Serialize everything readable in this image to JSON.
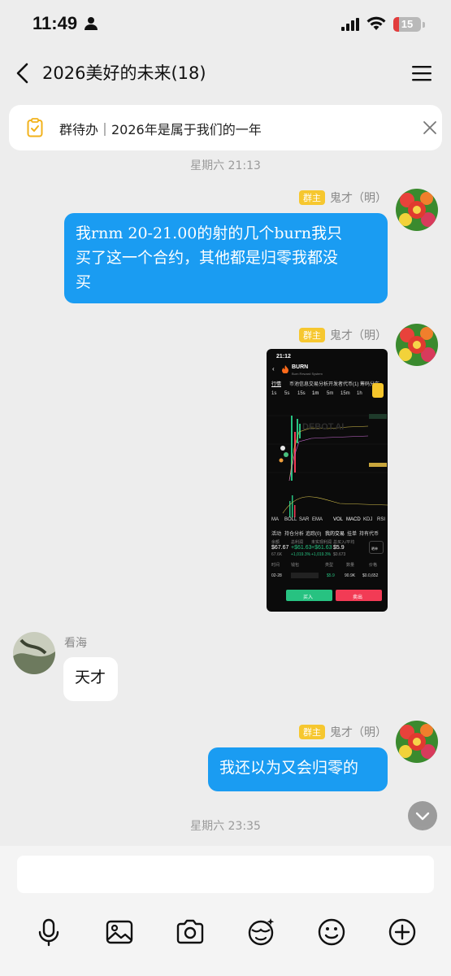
{
  "status_bar": {
    "time": "11:49",
    "battery": "15"
  },
  "header": {
    "title": "2026美好的未来(18)"
  },
  "group_todo": {
    "text": "群待办｜2026年是属于我们的一年"
  },
  "messages": [
    {
      "type": "timestamp",
      "text": "星期六 21:13"
    },
    {
      "type": "outgoing_text",
      "badge": "群主",
      "sender": "鬼才（明）",
      "lines": [
        "我rnm 20-21.00的射的几个burn我只",
        "买了这一个合约，其他都是归零我都没",
        "买"
      ]
    },
    {
      "type": "outgoing_image",
      "badge": "群主",
      "sender": "鬼才（明）",
      "image": {
        "time": "21:12",
        "token": "BURN",
        "subtitle": "Burn Reward System",
        "tabs": [
          "行情",
          "币池信息",
          "交易分析",
          "开发者代币(1)",
          "筹码分布"
        ],
        "intervals": [
          "1s",
          "5s",
          "15s",
          "1m",
          "5m",
          "15m",
          "1h"
        ],
        "watermark": "DEBOT.AI",
        "indicators": [
          "MA",
          "BOLL",
          "SAR",
          "EMA",
          "VOL",
          "MACD",
          "KDJ",
          "RSI"
        ],
        "sub_tabs": [
          "活动",
          "持仓分析",
          "追踪(0)",
          "我的交易",
          "挂单",
          "持有代币"
        ],
        "stats": [
          {
            "label": "余额",
            "value": "$67.67",
            "sub": "67.6K"
          },
          {
            "label": "总利润",
            "value": "+$61.63",
            "sub": "+1,019.3%"
          },
          {
            "label": "未实现利润",
            "value": "+$61.63",
            "sub": "+1,019.3%"
          },
          {
            "label": "总买入/平均",
            "value": "$5.9",
            "sub": "$0.673"
          }
        ],
        "share": "晒单",
        "table_headers": [
          "时间",
          "钱包",
          "类型",
          "数量",
          "价格"
        ],
        "row": {
          "date": "02-28",
          "type_value": "$5.9",
          "qty": "90.9K",
          "price": "$0.0,652"
        },
        "buy": "买入",
        "sell": "卖出"
      }
    },
    {
      "type": "incoming_text",
      "sender": "看海",
      "text": "天才"
    },
    {
      "type": "outgoing_text",
      "badge": "群主",
      "sender": "鬼才（明）",
      "lines": [
        "我还以为又会归零的"
      ]
    },
    {
      "type": "timestamp",
      "text": "星期六 23:35"
    }
  ],
  "toolbar": {
    "items": [
      "microphone-icon",
      "image-icon",
      "camera-icon",
      "sticker-icon",
      "emoji-icon",
      "plus-icon"
    ]
  },
  "colors": {
    "bubble_out": "#1a9cf2",
    "badge": "#f6c72f",
    "buy": "#27c281",
    "sell": "#f23b55"
  }
}
